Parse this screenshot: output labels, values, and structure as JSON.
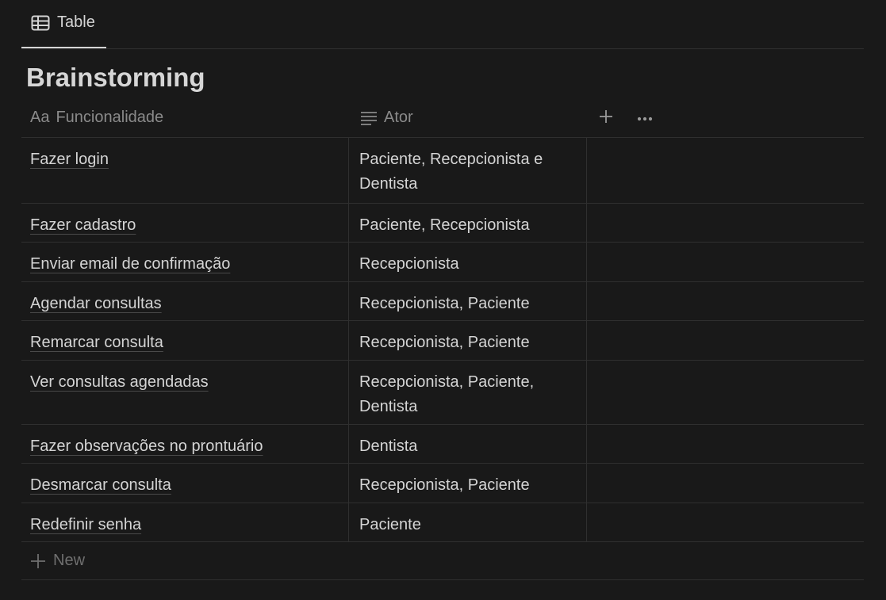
{
  "view_tab": {
    "icon": "table-icon",
    "label": "Table"
  },
  "title": "Brainstorming",
  "columns": [
    {
      "icon": "text-type-icon",
      "icon_text": "Aa",
      "label": "Funcionalidade"
    },
    {
      "icon": "lines-icon",
      "label": "Ator"
    }
  ],
  "rows": [
    {
      "funcionalidade": "Fazer login",
      "ator": "Paciente, Recepcionista e Dentista"
    },
    {
      "funcionalidade": "Fazer cadastro",
      "ator": "Paciente, Recepcionista"
    },
    {
      "funcionalidade": "Enviar email de confirmação",
      "ator": "Recepcionista"
    },
    {
      "funcionalidade": "Agendar consultas",
      "ator": "Recepcionista, Paciente"
    },
    {
      "funcionalidade": "Remarcar consulta",
      "ator": "Recepcionista, Paciente"
    },
    {
      "funcionalidade": "Ver consultas agendadas",
      "ator": "Recepcionista, Paciente, Dentista"
    },
    {
      "funcionalidade": "Fazer observações no prontuário",
      "ator": "Dentista"
    },
    {
      "funcionalidade": "Desmarcar consulta",
      "ator": "Recepcionista, Paciente"
    },
    {
      "funcionalidade": "Redefinir senha",
      "ator": "Paciente"
    }
  ],
  "new_row_label": "New",
  "colors": {
    "background": "#191919",
    "text": "#d4d4d4",
    "muted": "#8a8a8a",
    "border": "#2f2f2f"
  }
}
